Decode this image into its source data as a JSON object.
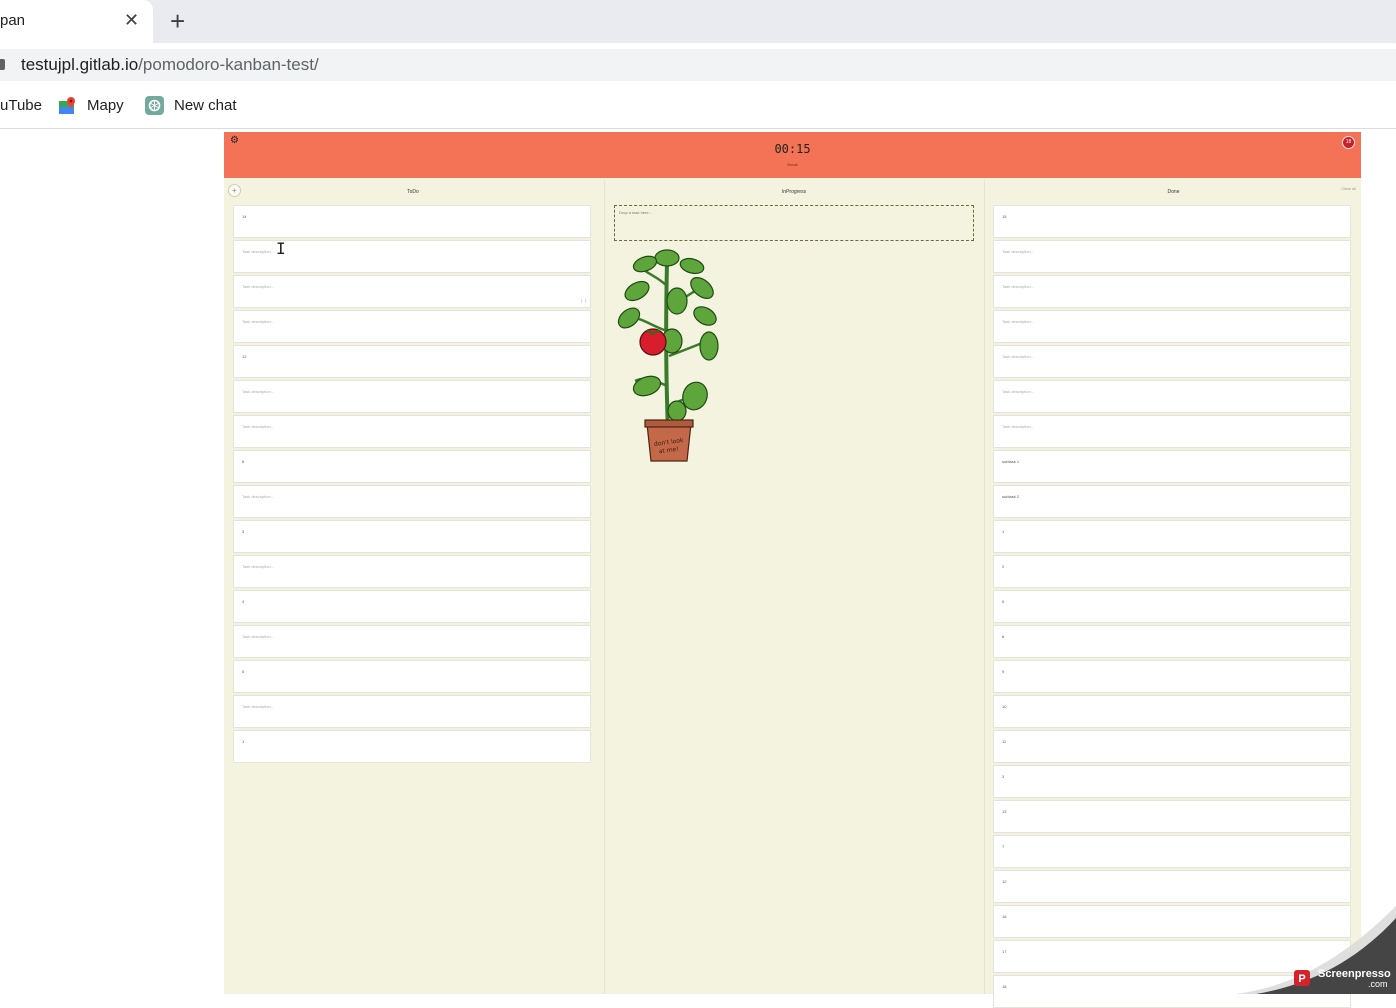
{
  "browser": {
    "tab_title": "pan",
    "close_glyph": "✕",
    "new_tab_glyph": "+",
    "url_host": "testujpl.gitlab.io",
    "url_path": "/pomodoro-kanban-test/",
    "bookmarks": [
      {
        "label": "uTube",
        "icon": "youtube-icon"
      },
      {
        "label": "Mapy",
        "icon": "maps-icon"
      },
      {
        "label": "New chat",
        "icon": "chatgpt-icon"
      }
    ]
  },
  "app": {
    "timer": "00:15",
    "phase": "Break",
    "tomato_count": "18",
    "gear_glyph": "⚙",
    "add_glyph": "+",
    "clear_all": "Clear all",
    "columns": {
      "todo": "ToDo",
      "inprogress": "InProgress",
      "done": "Done"
    },
    "dropzone_text": "Drop a task here...",
    "todo_cards": [
      "14",
      "Task description...",
      "Task description...",
      "Task description...",
      "12",
      "Task description...",
      "Task description...",
      "6",
      "Task description...",
      "3",
      "Task description...",
      "4",
      "Task description...",
      "5",
      "Task description...",
      "1"
    ],
    "done_cards": [
      "15",
      "Task description...",
      "Task description...",
      "Task description...",
      "Task description...",
      "Task description...",
      "Task description...",
      "subtask 1",
      "subtask 2",
      "1",
      "2",
      "5",
      "8",
      "9",
      "10",
      "11",
      "3",
      "13",
      "7",
      "12",
      "16",
      "17",
      "18"
    ],
    "plant_sign": "don't look at me!",
    "colors": {
      "header": "#f47356",
      "board": "#f4f3e0",
      "card": "#ffffff",
      "tomato": "#c8202b"
    }
  },
  "watermark": {
    "label": "Screenpresso",
    "sublabel": ".com"
  },
  "cursor_glyph": "I"
}
